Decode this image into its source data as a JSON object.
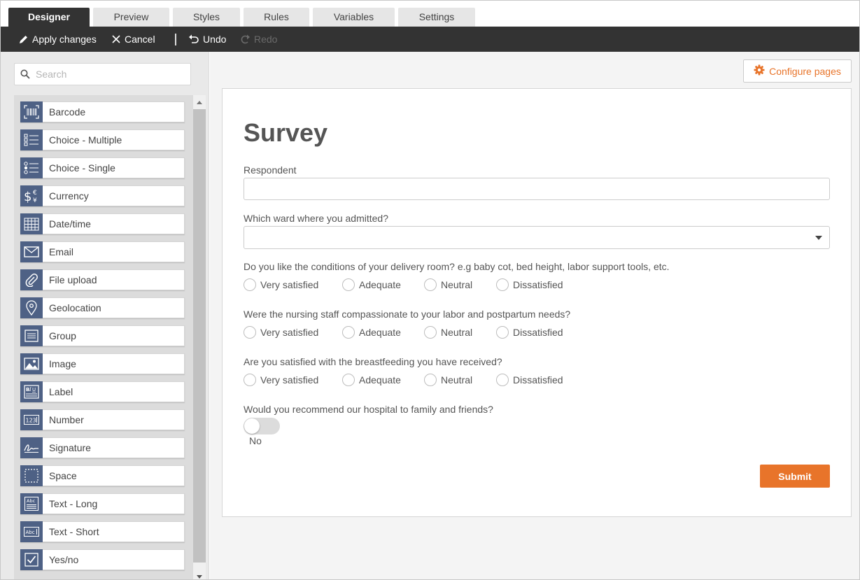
{
  "tabs": [
    "Designer",
    "Preview",
    "Styles",
    "Rules",
    "Variables",
    "Settings"
  ],
  "toolbar": {
    "apply": "Apply changes",
    "cancel": "Cancel",
    "undo": "Undo",
    "redo": "Redo"
  },
  "search": {
    "placeholder": "Search"
  },
  "palette": [
    {
      "label": "Barcode",
      "icon": "barcode-icon"
    },
    {
      "label": "Choice - Multiple",
      "icon": "checklist-icon"
    },
    {
      "label": "Choice - Single",
      "icon": "radio-list-icon"
    },
    {
      "label": "Currency",
      "icon": "currency-icon"
    },
    {
      "label": "Date/time",
      "icon": "calendar-icon"
    },
    {
      "label": "Email",
      "icon": "envelope-icon"
    },
    {
      "label": "File upload",
      "icon": "paperclip-icon"
    },
    {
      "label": "Geolocation",
      "icon": "map-pin-icon"
    },
    {
      "label": "Group",
      "icon": "group-icon"
    },
    {
      "label": "Image",
      "icon": "image-icon"
    },
    {
      "label": "Label",
      "icon": "label-icon"
    },
    {
      "label": "Number",
      "icon": "number-icon"
    },
    {
      "label": "Signature",
      "icon": "signature-icon"
    },
    {
      "label": "Space",
      "icon": "space-icon"
    },
    {
      "label": "Text - Long",
      "icon": "text-long-icon"
    },
    {
      "label": "Text - Short",
      "icon": "text-short-icon"
    },
    {
      "label": "Yes/no",
      "icon": "checkbox-icon"
    }
  ],
  "configure_pages": "Configure pages",
  "form": {
    "title": "Survey",
    "respondent_label": "Respondent",
    "respondent_value": "",
    "ward_label": "Which ward where you admitted?",
    "ward_value": "",
    "questions": [
      "Do you like the conditions of your delivery room? e.g  baby cot, bed height, labor support tools, etc.",
      "Were the nursing staff compassionate to your labor and postpartum needs?",
      "Are you satisfied with the breastfeeding you have received?"
    ],
    "options": [
      "Very satisfied",
      "Adequate",
      "Neutral",
      "Dissatisfied"
    ],
    "recommend_label": "Would you recommend our hospital to family and friends?",
    "recommend_value": "No",
    "submit": "Submit"
  },
  "colors": {
    "accent": "#e8742a",
    "toolbar_bg": "#333333",
    "palette_icon_bg": "#4e6185"
  }
}
